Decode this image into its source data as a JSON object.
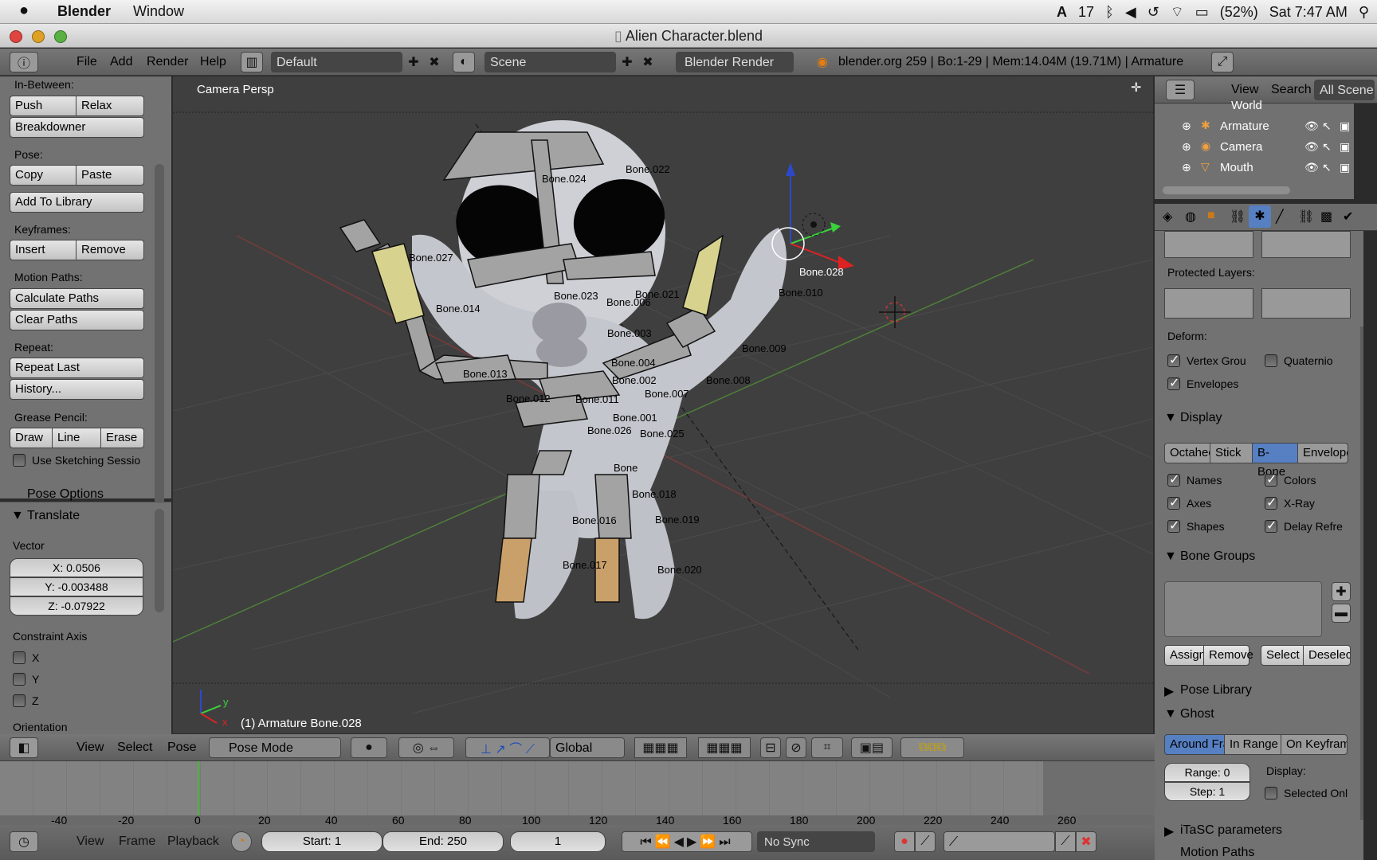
{
  "menubar": {
    "apple_icon": "apple-logo",
    "app_name": "Blender",
    "menu_window": "Window",
    "status_17": "17",
    "battery": "(52%)",
    "clock": "Sat 7:47 AM"
  },
  "window": {
    "title": "Alien Character.blend"
  },
  "info_header": {
    "menus": [
      "File",
      "Add",
      "Render",
      "Help"
    ],
    "layout": "Default",
    "scene": "Scene",
    "engine": "Blender Render",
    "stats": "blender.org 259 | Bo:1-29 | Mem:14.04M (19.71M) | Armature"
  },
  "toolshelf": {
    "in_between_label": "In-Between:",
    "push": "Push",
    "relax": "Relax",
    "breakdowner": "Breakdowner",
    "pose_label": "Pose:",
    "copy": "Copy",
    "paste": "Paste",
    "add_to_library": "Add To Library",
    "keyframes_label": "Keyframes:",
    "insert": "Insert",
    "remove": "Remove",
    "motion_paths_label": "Motion Paths:",
    "calculate_paths": "Calculate Paths",
    "clear_paths": "Clear Paths",
    "repeat_label": "Repeat:",
    "repeat_last": "Repeat Last",
    "history": "History...",
    "grease_label": "Grease Pencil:",
    "draw": "Draw",
    "line": "Line",
    "erase": "Erase",
    "use_sketching": "Use Sketching Sessio",
    "pose_options": "Pose Options"
  },
  "operator": {
    "title": "Translate",
    "vector_label": "Vector",
    "x": "X: 0.0506",
    "y": "Y: -0.003488",
    "z": "Z: -0.07922",
    "constraint_label": "Constraint Axis",
    "cx": "X",
    "cy": "Y",
    "cz": "Z",
    "orientation_label": "Orientation"
  },
  "viewport": {
    "view_name": "Camera Persp",
    "status": "(1) Armature Bone.028",
    "bones": [
      "Bone.022",
      "Bone.024",
      "Bone.027",
      "Bone.014",
      "Bone.023",
      "Bone.006",
      "Bone.021",
      "Bone.003",
      "Bone.004",
      "Bone.002",
      "Bone.013",
      "Bone.012",
      "Bone.011",
      "Bone.007",
      "Bone.008",
      "Bone.001",
      "Bone.026",
      "Bone.025",
      "Bone",
      "Bone.018",
      "Bone.016",
      "Bone.019",
      "Bone.017",
      "Bone.020",
      "Bone.028",
      "Bone.010",
      "Bone.009"
    ],
    "axis_y": "y",
    "axis_x": "x"
  },
  "view3d_header": {
    "menus": [
      "View",
      "Select",
      "Pose"
    ],
    "mode": "Pose Mode",
    "orientation": "Global"
  },
  "outliner": {
    "menus": [
      "View",
      "Search"
    ],
    "filter": "All Scene",
    "items": [
      "World",
      "Armature",
      "Camera",
      "Mouth"
    ]
  },
  "properties": {
    "protected_layers": "Protected Layers:",
    "deform_label": "Deform:",
    "vertex_groups": "Vertex Grou",
    "quaternion": "Quaternio",
    "envelopes": "Envelopes",
    "display_title": "Display",
    "display_modes": [
      "Octahec",
      "Stick",
      "B-Bone",
      "Envelope"
    ],
    "names": "Names",
    "colors": "Colors",
    "axes": "Axes",
    "xray": "X-Ray",
    "shapes": "Shapes",
    "delay": "Delay Refre",
    "bone_groups_title": "Bone Groups",
    "assign": "Assign",
    "remove": "Remove",
    "select": "Select",
    "deselect": "Deselec",
    "pose_library": "Pose Library",
    "ghost_title": "Ghost",
    "ghost_modes": [
      "Around Fra",
      "In Range",
      "On Keyfram"
    ],
    "range": "Range: 0",
    "step": "Step: 1",
    "display_small": "Display:",
    "selected_only": "Selected Onl",
    "itasc": "iTaSC parameters",
    "motion_paths": "Motion Paths"
  },
  "timeline": {
    "ticks": [
      "-40",
      "-20",
      "0",
      "20",
      "40",
      "60",
      "80",
      "100",
      "120",
      "140",
      "160",
      "180",
      "200",
      "220",
      "240",
      "260"
    ],
    "menus": [
      "View",
      "Frame",
      "Playback"
    ],
    "start": "Start: 1",
    "end": "End: 250",
    "current": "1",
    "sync": "No Sync"
  },
  "colors": {
    "accent": "#5680c2",
    "bg": "#3f3f3f"
  }
}
